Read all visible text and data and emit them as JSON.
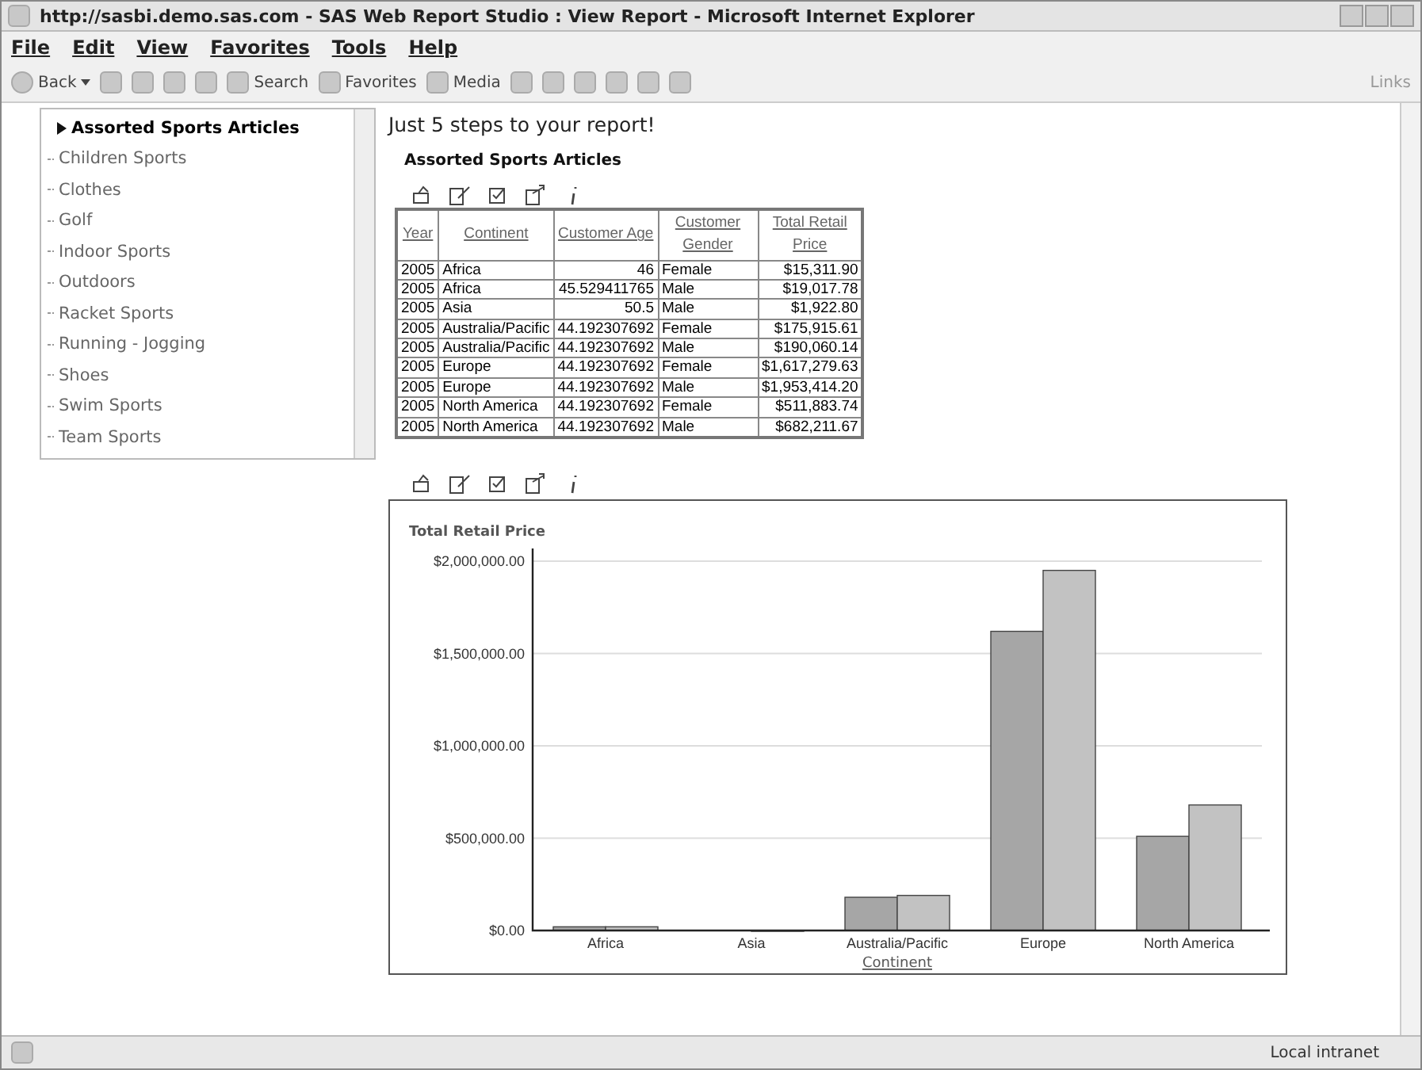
{
  "window": {
    "title": "http://sasbi.demo.sas.com - SAS Web Report Studio : View Report - Microsoft Internet Explorer"
  },
  "menu": [
    {
      "label": "File"
    },
    {
      "label": "Edit"
    },
    {
      "label": "View"
    },
    {
      "label": "Favorites"
    },
    {
      "label": "Tools"
    },
    {
      "label": "Help"
    }
  ],
  "toolbar": [
    {
      "kind": "back",
      "label": "Back"
    },
    {
      "kind": "icon"
    },
    {
      "kind": "icon"
    },
    {
      "kind": "icon"
    },
    {
      "kind": "icon"
    },
    {
      "kind": "text",
      "label": "Search"
    },
    {
      "kind": "text",
      "label": "Favorites"
    },
    {
      "kind": "text",
      "label": "Media"
    },
    {
      "kind": "icon"
    },
    {
      "kind": "icon"
    },
    {
      "kind": "icon"
    },
    {
      "kind": "icon"
    },
    {
      "kind": "icon"
    },
    {
      "kind": "icon"
    }
  ],
  "links": "Links",
  "sidebar": {
    "items": [
      {
        "label": "Assorted Sports Articles",
        "selected": true
      },
      {
        "label": "Children Sports",
        "selected": false
      },
      {
        "label": "Clothes",
        "selected": false
      },
      {
        "label": "Golf",
        "selected": false
      },
      {
        "label": "Indoor Sports",
        "selected": false
      },
      {
        "label": "Outdoors",
        "selected": false
      },
      {
        "label": "Racket Sports",
        "selected": false
      },
      {
        "label": "Running - Jogging",
        "selected": false
      },
      {
        "label": "Shoes",
        "selected": false
      },
      {
        "label": "Swim Sports",
        "selected": false
      },
      {
        "label": "Team Sports",
        "selected": false
      }
    ]
  },
  "report": {
    "heading": "Just 5 steps to your report!",
    "section_title": "Assorted Sports Articles",
    "table": {
      "columns": [
        "Year",
        "Continent",
        "Customer Age",
        "Customer Gender",
        "Total Retail Price"
      ],
      "rows": [
        [
          "2005",
          "Africa",
          "46",
          "Female",
          "$15,311.90"
        ],
        [
          "2005",
          "Africa",
          "45.529411765",
          "Male",
          "$19,017.78"
        ],
        [
          "2005",
          "Asia",
          "50.5",
          "Male",
          "$1,922.80"
        ],
        [
          "2005",
          "Australia/Pacific",
          "44.192307692",
          "Female",
          "$175,915.61"
        ],
        [
          "2005",
          "Australia/Pacific",
          "44.192307692",
          "Male",
          "$190,060.14"
        ],
        [
          "2005",
          "Europe",
          "44.192307692",
          "Female",
          "$1,617,279.63"
        ],
        [
          "2005",
          "Europe",
          "44.192307692",
          "Male",
          "$1,953,414.20"
        ],
        [
          "2005",
          "North America",
          "44.192307692",
          "Female",
          "$511,883.74"
        ],
        [
          "2005",
          "North America",
          "44.192307692",
          "Male",
          "$682,211.67"
        ]
      ]
    },
    "chart_data": {
      "type": "bar",
      "ylabel": "Total Retail Price",
      "xlabel": "Continent",
      "categories": [
        "Africa",
        "Asia",
        "Australia/Pacific",
        "Europe",
        "North America"
      ],
      "series": [
        {
          "color": "#a6a6a6",
          "values": [
            20000,
            null,
            180000,
            1620000,
            510000
          ]
        },
        {
          "color": "#c2c2c2",
          "values": [
            20000,
            0,
            190000,
            1950000,
            680000
          ]
        }
      ],
      "grid": true,
      "ylim": [
        0,
        2000000
      ],
      "yticks": [
        {
          "value": 0,
          "label": "$0.00"
        },
        {
          "value": 500000,
          "label": "$500,000.00"
        },
        {
          "value": 1000000,
          "label": "$1,000,000.00"
        },
        {
          "value": 1500000,
          "label": "$1,500,000.00"
        },
        {
          "value": 2000000,
          "label": "$2,000,000.00"
        }
      ]
    }
  },
  "status_bar": {
    "zone": "Local intranet"
  }
}
